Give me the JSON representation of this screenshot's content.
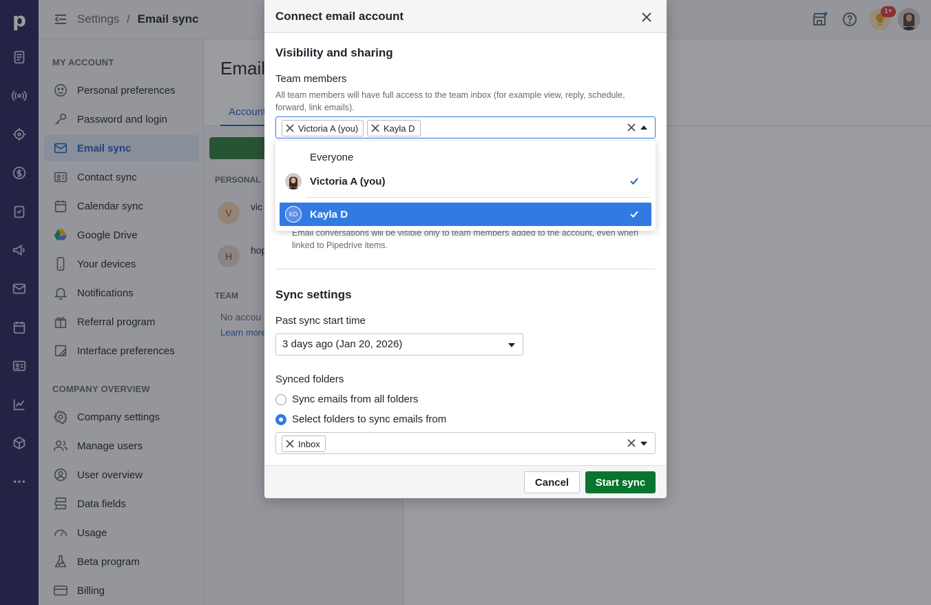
{
  "topbar": {
    "breadcrumb_root": "Settings",
    "breadcrumb_sep": "/",
    "breadcrumb_current": "Email sync",
    "notifications_badge": "1+"
  },
  "sidebar": {
    "section_my_account": "MY ACCOUNT",
    "section_company": "COMPANY OVERVIEW",
    "my_account_items": [
      {
        "label": "Personal preferences",
        "icon": "smile-icon"
      },
      {
        "label": "Password and login",
        "icon": "key-icon"
      },
      {
        "label": "Email sync",
        "icon": "envelope-icon"
      },
      {
        "label": "Contact sync",
        "icon": "contact-card-icon"
      },
      {
        "label": "Calendar sync",
        "icon": "calendar-icon"
      },
      {
        "label": "Google Drive",
        "icon": "google-drive-icon"
      },
      {
        "label": "Your devices",
        "icon": "phone-icon"
      },
      {
        "label": "Notifications",
        "icon": "bell-icon"
      },
      {
        "label": "Referral program",
        "icon": "gift-icon"
      },
      {
        "label": "Interface preferences",
        "icon": "edit-layout-icon"
      }
    ],
    "company_items": [
      {
        "label": "Company settings",
        "icon": "gear-icon"
      },
      {
        "label": "Manage users",
        "icon": "users-icon"
      },
      {
        "label": "User overview",
        "icon": "user-circle-icon"
      },
      {
        "label": "Data fields",
        "icon": "data-fields-icon"
      },
      {
        "label": "Usage",
        "icon": "gauge-icon"
      },
      {
        "label": "Beta program",
        "icon": "flask-icon"
      },
      {
        "label": "Billing",
        "icon": "credit-card-icon"
      }
    ]
  },
  "background": {
    "page_title": "Email",
    "tab_label": "Account",
    "personal_label": "PERSONAL",
    "team_label": "TEAM",
    "account1_initial": "V",
    "account1_name": "vic",
    "account2_initial": "H",
    "account2_name": "hop",
    "no_accounts": "No accou",
    "learn_more": "Learn more"
  },
  "modal": {
    "title": "Connect email account",
    "visibility_title": "Visibility and sharing",
    "team_members_label": "Team members",
    "team_members_help": "All team members will have full access to the team inbox (for example view, reply, schedule, forward, link emails).",
    "chips": [
      "Victoria A (you)",
      "Kayla D"
    ],
    "dropdown_options": [
      {
        "label": "Everyone",
        "checked": false
      },
      {
        "label": "Victoria A (you)",
        "checked": true
      },
      {
        "label": "Kayla D",
        "checked": true,
        "initials": "KD"
      }
    ],
    "privacy_help": "Email conversations will be visible only to team members added to the account, even when linked to Pipedrive items.",
    "sync_title": "Sync settings",
    "past_sync_label": "Past sync start time",
    "past_sync_value": "3 days ago (Jan 20, 2026)",
    "synced_folders_label": "Synced folders",
    "radio_all": "Sync emails from all folders",
    "radio_select": "Select folders to sync emails from",
    "folder_chips": [
      "Inbox"
    ],
    "cancel_label": "Cancel",
    "start_label": "Start sync"
  },
  "colors": {
    "rail": "#26235a",
    "accent": "#317ae2",
    "primary_button": "#08752e"
  }
}
